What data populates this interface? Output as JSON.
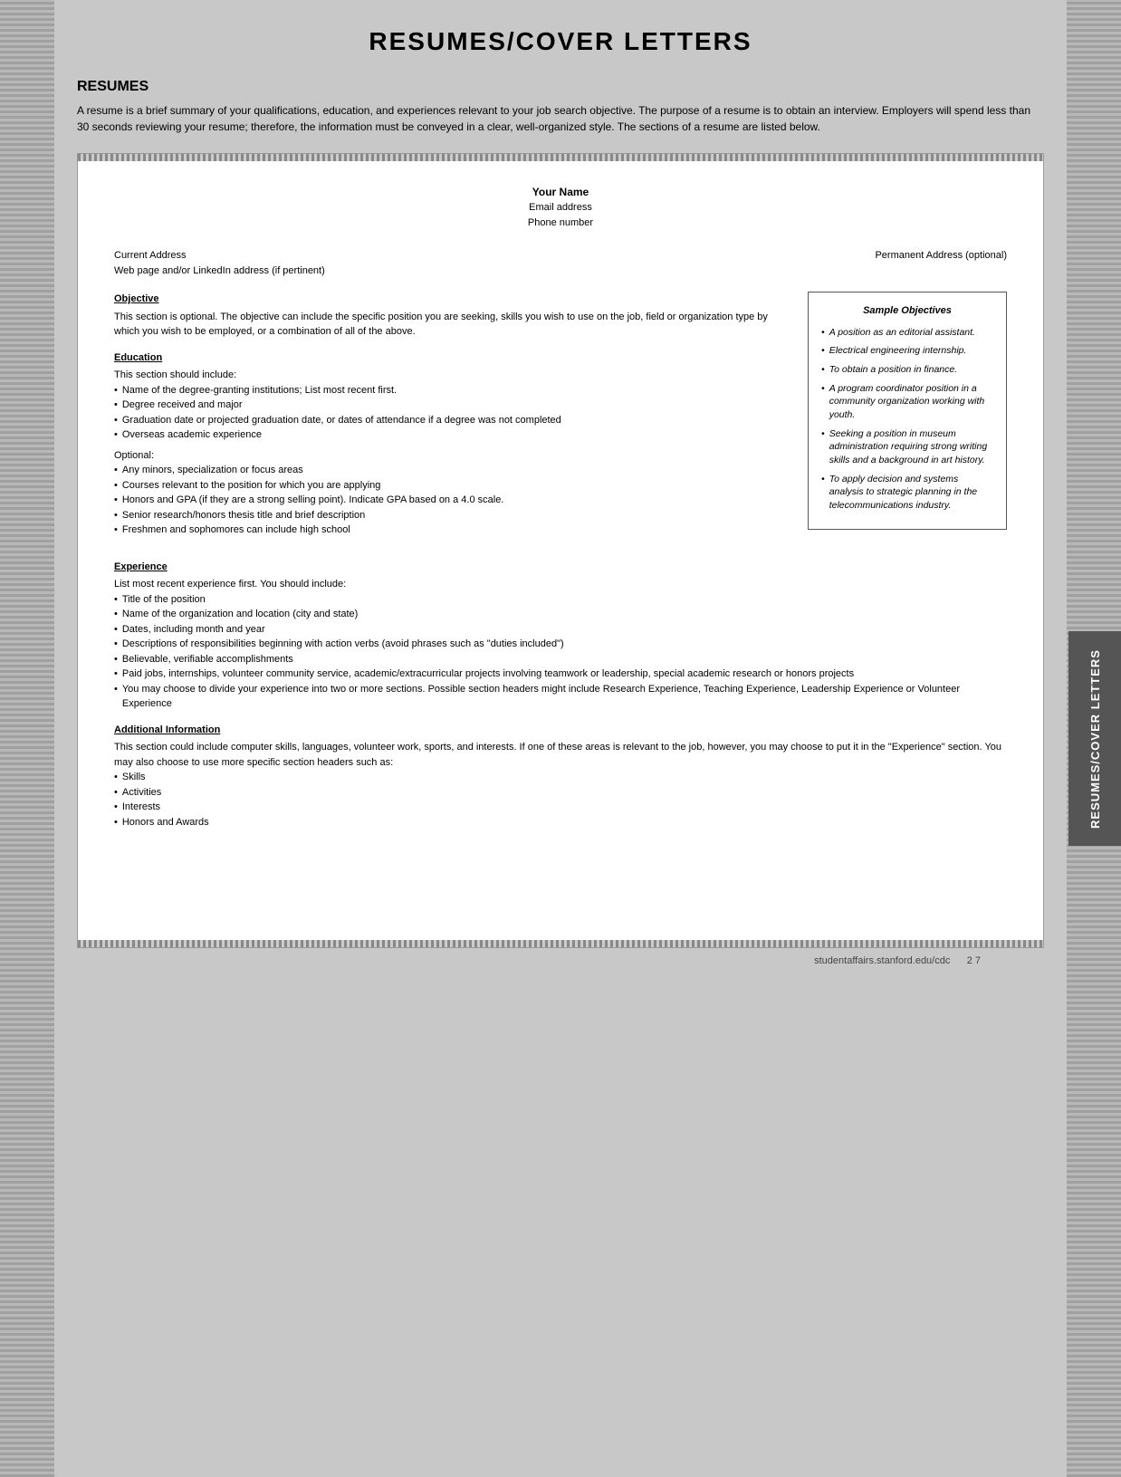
{
  "page": {
    "title": "RESUMES/COVER LETTERS",
    "footer_url": "studentaffairs.stanford.edu/cdc",
    "footer_page": "2 7"
  },
  "vertical_tab": {
    "text": "RESUMES/COVER LETTERS"
  },
  "resumes_section": {
    "heading": "RESUMES",
    "intro": "A resume is a brief summary of your qualifications, education, and experiences relevant to your job search objective. The purpose of a resume is to obtain an interview. Employers will spend less than 30 seconds reviewing your resume; therefore, the information must be conveyed in a clear, well-organized style. The sections of a resume are listed below."
  },
  "document": {
    "header": {
      "name": "Your Name",
      "email": "Email address",
      "phone": "Phone number"
    },
    "address": {
      "current": "Current Address",
      "web": "Web page and/or LinkedIn address (if pertinent)",
      "permanent": "Permanent Address (optional)"
    },
    "objective": {
      "title": "Objective",
      "text": "This section is optional. The objective can include the specific position you are seeking, skills you wish to use on the job, field or organization type by which you wish to be employed, or a combination of all of the above."
    },
    "sample_objectives": {
      "title": "Sample Objectives",
      "items": [
        "A position as an editorial assistant.",
        "Electrical engineering internship.",
        "To obtain a position in finance.",
        "A program coordinator position in a community organization working with youth.",
        "Seeking a position in museum administration requiring strong writing skills and a background in art history.",
        "To apply decision and systems analysis to strategic planning in the telecommunications industry."
      ]
    },
    "education": {
      "title": "Education",
      "intro": "This section should include:",
      "required_bullets": [
        "Name of the degree-granting institutions; List most recent first.",
        "Degree received and major",
        "Graduation date or projected graduation date, or dates of attendance if a degree was not completed",
        "Overseas academic experience"
      ],
      "optional_label": "Optional:",
      "optional_bullets": [
        "Any minors, specialization or focus areas",
        "Courses relevant to the position for which you are applying",
        "Honors and GPA (if they are a strong selling point). Indicate GPA based on a 4.0 scale.",
        "Senior research/honors thesis title and brief description",
        "Freshmen and sophomores can include high school"
      ]
    },
    "experience": {
      "title": "Experience",
      "intro": "List most recent experience first. You should include:",
      "bullets": [
        "Title of the position",
        "Name of the organization and location (city and state)",
        "Dates, including month and year",
        "Descriptions of responsibilities beginning with action verbs (avoid phrases such as \"duties included\")",
        "Believable, verifiable accomplishments",
        "Paid jobs, internships, volunteer community service, academic/extracurricular projects involving teamwork or leadership, special academic research or honors projects",
        "You may choose to divide your experience into two or more sections. Possible section headers might include Research Experience, Teaching Experience, Leadership Experience or Volunteer Experience"
      ]
    },
    "additional_info": {
      "title": "Additional Information",
      "text": "This section could include computer skills, languages, volunteer work, sports, and interests. If one of these areas is relevant to the job, however, you may choose to put it in the \"Experience\" section. You may also choose to use more specific section headers such as:",
      "bullets": [
        "Skills",
        "Activities",
        "Interests",
        "Honors and Awards"
      ]
    }
  }
}
